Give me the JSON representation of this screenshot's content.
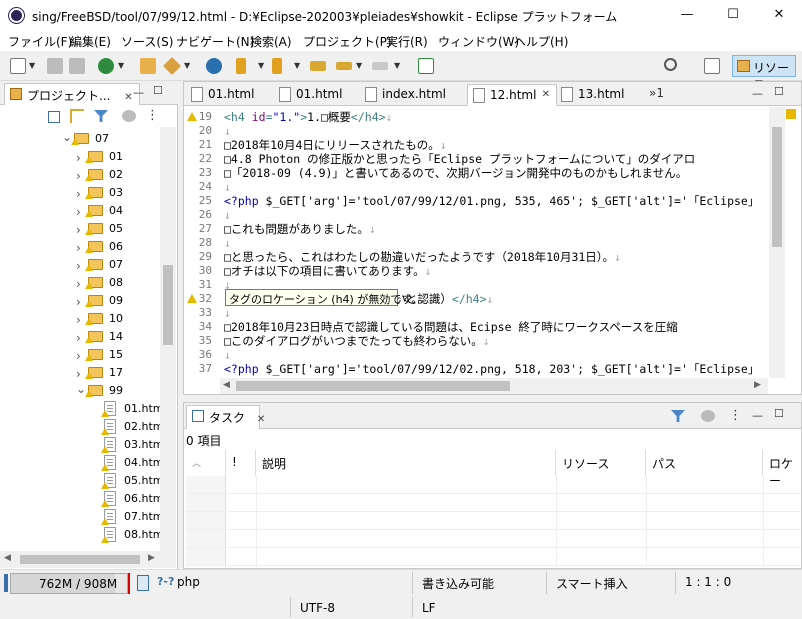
{
  "window": {
    "title": "sing/FreeBSD/tool/07/99/12.html - D:¥Eclipse-202003¥pleiades¥showkit - Eclipse プラットフォーム",
    "minimize": "—",
    "maximize": "☐",
    "close": "✕"
  },
  "menu": [
    "ファイル(F)",
    "編集(E)",
    "ソース(S)",
    "ナビゲート(N)",
    "検索(A)",
    "プロジェクト(P)",
    "実行(R)",
    "ウィンドウ(W)",
    "ヘルプ(H)"
  ],
  "perspective": {
    "label": "リソース"
  },
  "project_explorer": {
    "tab_label": "プロジェクト...",
    "close": "✕",
    "tree": [
      {
        "label": "07",
        "depth": 0,
        "kind": "folder",
        "open": true
      },
      {
        "label": "01",
        "depth": 1,
        "kind": "folder",
        "open": false
      },
      {
        "label": "02",
        "depth": 1,
        "kind": "folder",
        "open": false
      },
      {
        "label": "03",
        "depth": 1,
        "kind": "folder",
        "open": false
      },
      {
        "label": "04",
        "depth": 1,
        "kind": "folder",
        "open": false
      },
      {
        "label": "05",
        "depth": 1,
        "kind": "folder",
        "open": false
      },
      {
        "label": "06",
        "depth": 1,
        "kind": "folder",
        "open": false
      },
      {
        "label": "07",
        "depth": 1,
        "kind": "folder",
        "open": false
      },
      {
        "label": "08",
        "depth": 1,
        "kind": "folder",
        "open": false
      },
      {
        "label": "09",
        "depth": 1,
        "kind": "folder",
        "open": false
      },
      {
        "label": "10",
        "depth": 1,
        "kind": "folder",
        "open": false
      },
      {
        "label": "14",
        "depth": 1,
        "kind": "folder",
        "open": false
      },
      {
        "label": "15",
        "depth": 1,
        "kind": "folder",
        "open": false
      },
      {
        "label": "17",
        "depth": 1,
        "kind": "folder",
        "open": false
      },
      {
        "label": "99",
        "depth": 1,
        "kind": "folder",
        "open": true
      },
      {
        "label": "01.htm",
        "depth": 2,
        "kind": "file"
      },
      {
        "label": "02.htm",
        "depth": 2,
        "kind": "file"
      },
      {
        "label": "03.htm",
        "depth": 2,
        "kind": "file"
      },
      {
        "label": "04.htm",
        "depth": 2,
        "kind": "file"
      },
      {
        "label": "05.htm",
        "depth": 2,
        "kind": "file"
      },
      {
        "label": "06.htm",
        "depth": 2,
        "kind": "file"
      },
      {
        "label": "07.htm",
        "depth": 2,
        "kind": "file"
      },
      {
        "label": "08.htm",
        "depth": 2,
        "kind": "file"
      }
    ]
  },
  "editor": {
    "tabs": [
      {
        "label": "01.html",
        "active": false
      },
      {
        "label": "01.html",
        "active": false
      },
      {
        "label": "index.html",
        "active": false
      },
      {
        "label": "12.html",
        "active": true
      },
      {
        "label": "13.html",
        "active": false
      }
    ],
    "overflow": "»1",
    "close": "✕",
    "lines": [
      {
        "n": "19",
        "parts": [
          [
            "tag",
            "<h4 "
          ],
          [
            "attr",
            "id"
          ],
          [
            "tag",
            "="
          ],
          [
            "php",
            "\"1.\""
          ],
          [
            "tag",
            ">"
          ],
          [
            "",
            "1.□概要"
          ],
          [
            "tag",
            "</h4>"
          ],
          [
            "wsm",
            "↓"
          ]
        ],
        "warn": true
      },
      {
        "n": "20",
        "parts": [
          [
            "wsm",
            "↓"
          ]
        ]
      },
      {
        "n": "21",
        "parts": [
          [
            "",
            "□2018年10月4日にリリースされたもの。"
          ],
          [
            "wsm",
            "↓"
          ]
        ]
      },
      {
        "n": "22",
        "parts": [
          [
            "",
            "□4.8 Photon の修正版かと思ったら「Eclipse プラットフォームについて」のダイアロ"
          ]
        ]
      },
      {
        "n": "23",
        "parts": [
          [
            "",
            "□「2018-09 (4.9)」と書いてあるので、次期バージョン開発中のものかもしれません。"
          ]
        ]
      },
      {
        "n": "24",
        "parts": [
          [
            "wsm",
            "↓"
          ]
        ]
      },
      {
        "n": "25",
        "parts": [
          [
            "php",
            "<?php"
          ],
          [
            "",
            " $_GET['arg']='tool/07/99/12/01.png, 535, 465'; $_GET['alt']='「Eclipse」"
          ]
        ]
      },
      {
        "n": "26",
        "parts": [
          [
            "wsm",
            "↓"
          ]
        ]
      },
      {
        "n": "27",
        "parts": [
          [
            "",
            "□これも問題がありました。"
          ],
          [
            "wsm",
            "↓"
          ]
        ]
      },
      {
        "n": "28",
        "parts": [
          [
            "wsm",
            "↓"
          ]
        ]
      },
      {
        "n": "29",
        "parts": [
          [
            "",
            "□と思ったら、これはわたしの勘違いだったようです（2018年10月31日）。"
          ],
          [
            "wsm",
            "↓"
          ]
        ]
      },
      {
        "n": "30",
        "parts": [
          [
            "",
            "□オチは以下の項目に書いてあります。"
          ],
          [
            "wsm",
            "↓"
          ]
        ]
      },
      {
        "n": "31",
        "parts": [
          [
            "wsm",
            "↓"
          ]
        ]
      },
      {
        "n": "32",
        "parts": [
          [
            "",
            "                  る問題（2018年10月31日で勘違いと認識）"
          ],
          [
            "tag",
            "</h4>"
          ],
          [
            "wsm",
            "↓"
          ]
        ],
        "warn": true
      },
      {
        "n": "33",
        "parts": [
          [
            "wsm",
            "↓"
          ]
        ]
      },
      {
        "n": "34",
        "parts": [
          [
            "",
            "□2018年10月23日時点で認識している問題は、Ecipse 終了時にワークスペースを圧縮"
          ]
        ]
      },
      {
        "n": "35",
        "parts": [
          [
            "",
            "□このダイアログがいつまでたっても終わらない。"
          ],
          [
            "wsm",
            "↓"
          ]
        ]
      },
      {
        "n": "36",
        "parts": [
          [
            "wsm",
            "↓"
          ]
        ]
      },
      {
        "n": "37",
        "parts": [
          [
            "php",
            "<?php"
          ],
          [
            "",
            " $_GET['arg']='tool/07/99/12/02.png, 518, 203'; $_GET['alt']='「Eclipse」"
          ]
        ]
      }
    ],
    "tooltip": "タグのロケーション (h4) が無効です。"
  },
  "tasks": {
    "tab_label": "タスク",
    "close": "✕",
    "count": "0 項目",
    "columns": [
      "!",
      "説明",
      "リソース",
      "パス",
      "ロケー"
    ]
  },
  "status": {
    "heap": "762M / 908M",
    "filetype": "php",
    "writable": "書き込み可能",
    "insert_mode": "スマート挿入",
    "position": "1 : 1 : 0",
    "encoding": "UTF-8",
    "line_delim": "LF"
  }
}
